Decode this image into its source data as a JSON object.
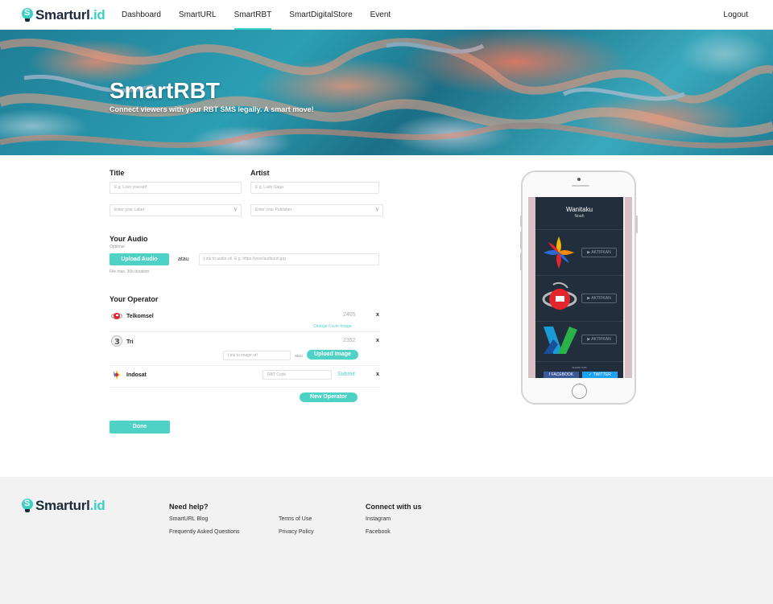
{
  "brand": {
    "name": "Smarturl",
    "suffix": ".id",
    "logo_icon": "lightbulb-s-icon"
  },
  "nav": {
    "links": [
      "Dashboard",
      "SmartURL",
      "SmartRBT",
      "SmartDigitalStore",
      "Event"
    ],
    "active": "SmartRBT",
    "logout": "Logout"
  },
  "hero": {
    "title": "SmartRBT",
    "subtitle": "Connect viewers with your RBT SMS legally. A smart move!"
  },
  "form": {
    "title_label": "Title",
    "title_placeholder": "E.g. Love yourself",
    "artist_label": "Artist",
    "artist_placeholder": "E.g. Lady Gaga",
    "label_select": "Enter your Label",
    "publisher_select": "Enter your Publisher",
    "caret": "v",
    "audio_label": "Your Audio",
    "audio_optional": "Optional",
    "upload_audio": "Upload Audio",
    "atau": "atau",
    "audio_url_placeholder": "Link to audio url. E.g. https://your/audio/url.jpg",
    "audio_note": "File max. 30s duration",
    "operator_label": "Your Operator",
    "operators": [
      {
        "name": "Telkomsel",
        "code": "2405",
        "action": "Change Cover Image",
        "remove": "x"
      },
      {
        "name": "Tri",
        "code": "2352",
        "image_placeholder": "Link to image url",
        "atau": "atau",
        "upload": "Upload Image",
        "remove": "x"
      },
      {
        "name": "Indosat",
        "code_placeholder": "RBT Code",
        "submit": "Submit",
        "remove": "x"
      }
    ],
    "new_operator": "New Operator",
    "done": "Done"
  },
  "preview": {
    "song": "Wanitaku",
    "artist": "Noah",
    "activate": "AKTIFKAN",
    "share": "SHARE THIS",
    "facebook": "FACEBOOK",
    "twitter": "TWITTER"
  },
  "footer": {
    "help_heading": "Need help?",
    "help_col1": [
      "SmartURL Blog",
      "Frequently Asked Questions"
    ],
    "help_col2": [
      "Terms of Use",
      "Privacy Policy"
    ],
    "connect_heading": "Connect with us",
    "connect_links": [
      "Instagram",
      "Facebook"
    ]
  },
  "colors": {
    "accent": "#4fd2c6",
    "brand_dark": "#1c2b3a"
  }
}
